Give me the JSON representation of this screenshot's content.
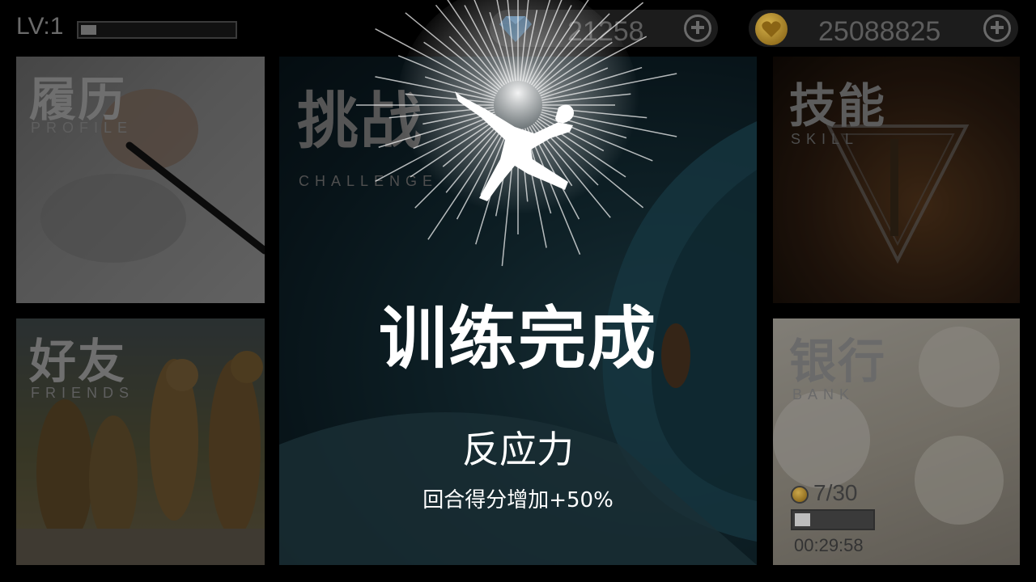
{
  "hud": {
    "level_label": "LV:1",
    "xp_progress": 0.1,
    "gems": "21258",
    "coins": "25088825"
  },
  "tiles": {
    "profile": {
      "cn": "履历",
      "en": "PROFILE"
    },
    "friends": {
      "cn": "好友",
      "en": "FRIENDS"
    },
    "challenge": {
      "cn": "挑战",
      "en": "CHALLENGE"
    },
    "skill": {
      "cn": "技能",
      "en": "SKILL"
    },
    "bank": {
      "cn": "银行",
      "en": "BANK",
      "count": "7/30",
      "progress": 0.2,
      "timer": "00:29:58"
    }
  },
  "overlay": {
    "title": "训练完成",
    "skill_name": "反应力",
    "description": "回合得分增加+50%"
  },
  "colors": {
    "background": "#000000",
    "gem": "#4a7fb0",
    "coin": "#c9a13d"
  },
  "icons": [
    "gem-icon",
    "coin-icon",
    "plus-icon",
    "jumping-figure-icon",
    "triangle-emblem-icon"
  ]
}
